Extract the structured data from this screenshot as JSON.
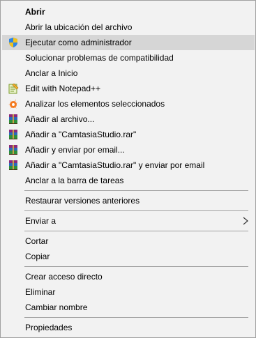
{
  "menu": {
    "items": [
      {
        "label": "Abrir"
      },
      {
        "label": "Abrir la ubicación del archivo"
      },
      {
        "label": "Ejecutar como administrador",
        "icon": "uac-shield-icon"
      },
      {
        "label": "Solucionar problemas de compatibilidad"
      },
      {
        "label": "Anclar a Inicio"
      },
      {
        "label": "Edit with Notepad++",
        "icon": "notepad-plus-plus-icon"
      },
      {
        "label": "Analizar los elementos seleccionados",
        "icon": "avast-icon"
      },
      {
        "label": "Añadir al archivo...",
        "icon": "winrar-icon"
      },
      {
        "label": "Añadir a \"CamtasiaStudio.rar\"",
        "icon": "winrar-icon"
      },
      {
        "label": "Añadir y enviar por email...",
        "icon": "winrar-icon"
      },
      {
        "label": "Añadir a \"CamtasiaStudio.rar\" y enviar por email",
        "icon": "winrar-icon"
      },
      {
        "label": "Anclar a la barra de tareas"
      },
      {
        "label": "Restaurar versiones anteriores"
      },
      {
        "label": "Enviar a",
        "icon": "chevron-right-icon"
      },
      {
        "label": "Cortar"
      },
      {
        "label": "Copiar"
      },
      {
        "label": "Crear acceso directo"
      },
      {
        "label": "Eliminar"
      },
      {
        "label": "Cambiar nombre"
      },
      {
        "label": "Propiedades"
      }
    ],
    "highlighted_item": "Ejecutar como administrador",
    "colors": {
      "background": "#f2f2f2",
      "highlight": "#d6d6d6",
      "separator": "#a0a0a0"
    }
  }
}
